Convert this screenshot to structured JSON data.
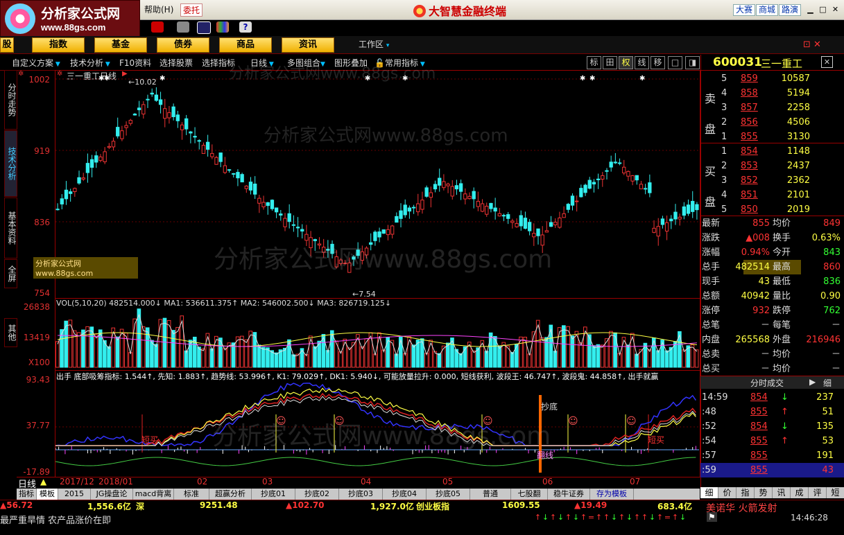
{
  "titlebar": {
    "logo_text": "分析家公式网",
    "logo_url": "www.88gs.com",
    "help": "帮助(H)",
    "entrust": "委托",
    "title": "大智慧金融终端",
    "buttons": [
      "大赛",
      "商城",
      "路演"
    ]
  },
  "nav": {
    "items": [
      "股",
      "指数",
      "基金",
      "债券",
      "商品",
      "资讯"
    ],
    "workarea": "工作区"
  },
  "subbar": {
    "items": [
      "自定义方案",
      "技术分析",
      "F10资料",
      "选择股票",
      "选择指标",
      "日线",
      "多图组合",
      "图形叠加",
      "常用指标"
    ],
    "right_tools": [
      "标",
      "田",
      "权",
      "线",
      "移",
      "□",
      "◨"
    ]
  },
  "sidetabs": [
    "分时走势",
    "技术分析",
    "基本资料",
    "全屏",
    "其他"
  ],
  "main_chart": {
    "title": "三一重工日线",
    "ylabels": [
      "1002",
      "919",
      "836",
      "754"
    ],
    "high_label": "10.02",
    "low_label": "7.54",
    "watermark_small": "分析家公式网www.88gs.com",
    "watermark": "分析家公式网www.88gs.com"
  },
  "vol_panel": {
    "header": "VOL(5,10,20) 482514.000↓ MA1: 536611.375↑ MA2: 546002.500↓ MA3: 826719.125↓",
    "ylabels": [
      "26838",
      "13419",
      "X100"
    ]
  },
  "ind_panel": {
    "header": "出手 底部吸筹指标: 1.544↑, 先知: 1.883↑, 趋势线: 53.996↑, K1: 79.029↑, DK1: 5.940↓, 可能放量拉升: 0.000, 短线获利, 波段王: 46.747↑, 波段鬼: 44.858↑, 出手就赢",
    "ylabels": [
      "93.43",
      "37.77",
      "-17.89"
    ],
    "labels": {
      "chaodi": "抄底",
      "kuaixian": "翻线",
      "chumai1": "短买",
      "chumai2": "短买"
    }
  },
  "time_axis": {
    "period": "日线",
    "labels": [
      "2017/12",
      "2018/01",
      "02",
      "03",
      "04",
      "05",
      "06",
      "07"
    ]
  },
  "bottom_tabs": [
    "指标",
    "模板",
    "2015",
    "JG操盘论",
    "macd背离",
    "标准",
    "超赢分析",
    "抄底01",
    "抄底02",
    "抄底03",
    "抄底04",
    "抄底05",
    "普通",
    "七股翻",
    "稳牛证券",
    "存为模板"
  ],
  "right_panel": {
    "code": "600031",
    "name": "三一重工",
    "sell": [
      {
        "n": "5",
        "p": "859",
        "v": "10587"
      },
      {
        "n": "4",
        "p": "858",
        "v": "5194"
      },
      {
        "n": "3",
        "p": "857",
        "v": "2258"
      },
      {
        "n": "2",
        "p": "856",
        "v": "4506"
      },
      {
        "n": "1",
        "p": "855",
        "v": "3130"
      }
    ],
    "buy": [
      {
        "n": "1",
        "p": "854",
        "v": "1148"
      },
      {
        "n": "2",
        "p": "853",
        "v": "2437"
      },
      {
        "n": "3",
        "p": "852",
        "v": "2362"
      },
      {
        "n": "4",
        "p": "851",
        "v": "2101"
      },
      {
        "n": "5",
        "p": "850",
        "v": "2019"
      }
    ],
    "sell_label": [
      "卖",
      "盘"
    ],
    "buy_label": [
      "买",
      "盘"
    ],
    "stats": [
      {
        "l1": "最新",
        "v1": "855",
        "l2": "均价",
        "v2": "849"
      },
      {
        "l1": "涨跌",
        "v1": "▲008",
        "l2": "换手",
        "v2": "0.63%"
      },
      {
        "l1": "涨幅",
        "v1": "0.94%",
        "l2": "今开",
        "v2": "843"
      },
      {
        "l1": "总手",
        "v1": "482514",
        "l2": "最高",
        "v2": "860"
      },
      {
        "l1": "现手",
        "v1": "43",
        "l2": "最低",
        "v2": "836"
      },
      {
        "l1": "总额",
        "v1": "40942",
        "l2": "量比",
        "v2": "0.90"
      },
      {
        "l1": "涨停",
        "v1": "932",
        "l2": "跌停",
        "v2": "762"
      },
      {
        "l1": "总笔",
        "v1": "－",
        "l2": "每笔",
        "v2": "－"
      },
      {
        "l1": "内盘",
        "v1": "265568",
        "l2": "外盘",
        "v2": "216946"
      },
      {
        "l1": "总卖",
        "v1": "－",
        "l2": "均价",
        "v2": "－"
      },
      {
        "l1": "总买",
        "v1": "－",
        "l2": "均价",
        "v2": "－"
      }
    ],
    "trades_title": "分时成交",
    "trades_tab": "细",
    "trades": [
      {
        "t": "14:59",
        "p": "854",
        "d": "↓",
        "v": "237"
      },
      {
        "t": ":48",
        "p": "855",
        "d": "↑",
        "v": "51"
      },
      {
        "t": ":52",
        "p": "854",
        "d": "↓",
        "v": "135"
      },
      {
        "t": ":54",
        "p": "855",
        "d": "↑",
        "v": "53"
      },
      {
        "t": ":57",
        "p": "855",
        "d": "",
        "v": "191"
      },
      {
        "t": ":59",
        "p": "855",
        "d": "",
        "v": "43"
      }
    ],
    "tabs": [
      "细",
      "价",
      "指",
      "势",
      "讯",
      "成",
      "评",
      "短"
    ]
  },
  "status": {
    "row1": [
      "▲56.72",
      "1,556.6亿",
      "深",
      "9251.48",
      "▲102.70",
      "1,927.0亿",
      "创业板指",
      "1609.55",
      "▲19.49",
      "683.4亿",
      "美诺华",
      "火箭发射"
    ],
    "row2": "最严重旱情 农产品涨价在即",
    "time": "14:46:28"
  }
}
